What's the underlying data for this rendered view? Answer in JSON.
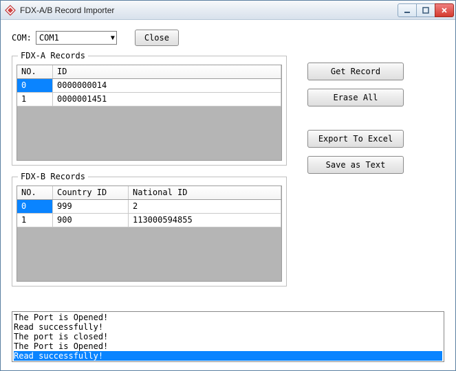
{
  "window": {
    "title": "FDX-A/B Record Importer"
  },
  "top": {
    "com_label": "COM:",
    "com_value": "COM1",
    "close_label": "Close"
  },
  "groups": {
    "a": {
      "title": "FDX-A Records",
      "head_no": "NO.",
      "head_id": "ID",
      "rows": [
        {
          "no": "0",
          "id": "0000000014"
        },
        {
          "no": "1",
          "id": "0000001451"
        }
      ]
    },
    "b": {
      "title": "FDX-B Records",
      "head_no": "NO.",
      "head_cid": "Country ID",
      "head_nid": "National ID",
      "rows": [
        {
          "no": "0",
          "cid": "999",
          "nid": "2"
        },
        {
          "no": "1",
          "cid": "900",
          "nid": "113000594855"
        }
      ]
    }
  },
  "buttons": {
    "get_record": "Get Record",
    "erase_all": "Erase All",
    "export_excel": "Export To Excel",
    "save_text": "Save as Text"
  },
  "log": {
    "lines": [
      "The Port is Opened!",
      "Read successfully!",
      "The port is closed!",
      "The Port is Opened!",
      "Read successfully!"
    ]
  }
}
